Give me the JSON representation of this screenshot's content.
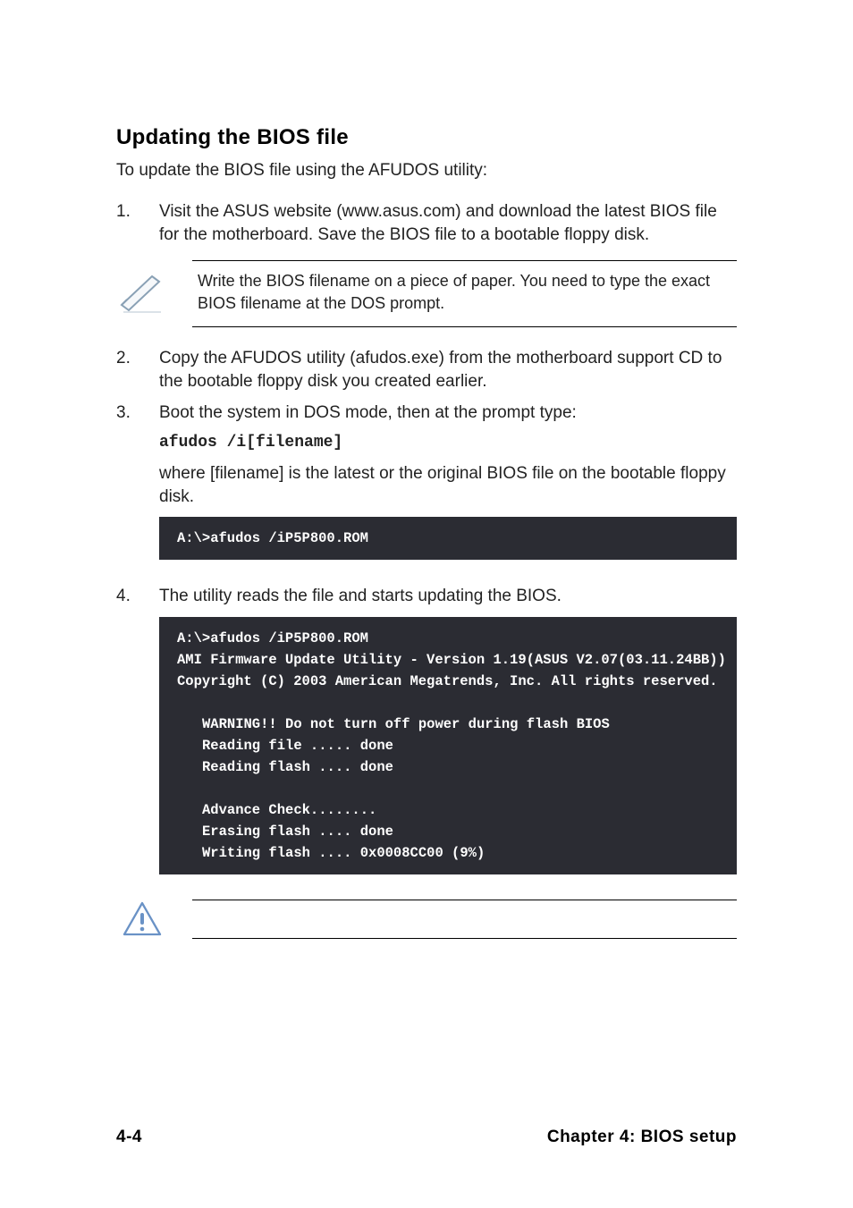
{
  "heading": "Updating the BIOS file",
  "intro": "To update the BIOS file using the AFUDOS utility:",
  "step1": {
    "num": "1.",
    "text": "Visit the ASUS website (www.asus.com) and download the latest BIOS file for the motherboard. Save the BIOS file to a bootable floppy disk."
  },
  "note1": "Write the BIOS filename on a piece of paper. You need to type the exact BIOS filename at the DOS prompt.",
  "step2": {
    "num": "2.",
    "text": "Copy the AFUDOS utility (afudos.exe) from the motherboard support CD to the bootable floppy disk you created earlier."
  },
  "step3": {
    "num": "3.",
    "line1": "Boot the system in DOS mode, then at the prompt type:",
    "cmd": "afudos /i[filename]",
    "line2": "where [filename] is the latest or the original BIOS file on the bootable floppy disk."
  },
  "terminal1": "A:\\>afudos /iP5P800.ROM",
  "step4": {
    "num": "4.",
    "text": "The utility reads the file and starts updating the BIOS."
  },
  "terminal2": {
    "l1": "A:\\>afudos /iP5P800.ROM",
    "l2": "AMI Firmware Update Utility - Version 1.19(ASUS V2.07(03.11.24BB))",
    "l3": "Copyright (C) 2003 American Megatrends, Inc. All rights reserved.",
    "l4": "WARNING!! Do not turn off power during flash BIOS",
    "l5": "Reading file ..... done",
    "l6": "Reading flash .... done",
    "l7": "Advance Check........",
    "l8": "Erasing flash .... done",
    "l9": "Writing flash .... 0x0008CC00 (9%)"
  },
  "footer": {
    "page": "4-4",
    "chapter": "Chapter 4: BIOS setup"
  }
}
